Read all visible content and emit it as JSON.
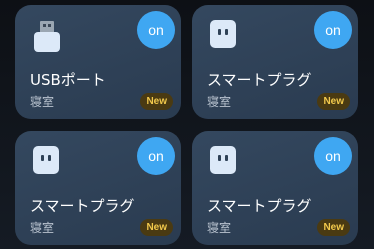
{
  "devices": [
    {
      "name": "USBポート",
      "room": "寝室",
      "toggle": "on",
      "badge": "New",
      "icon": "usb-stick-icon"
    },
    {
      "name": "スマートプラグ",
      "room": "寝室",
      "toggle": "on",
      "badge": "New",
      "icon": "smart-plug-icon"
    },
    {
      "name": "スマートプラグ",
      "room": "寝室",
      "toggle": "on",
      "badge": "New",
      "icon": "smart-plug-icon"
    },
    {
      "name": "スマートプラグ",
      "room": "寝室",
      "toggle": "on",
      "badge": "New",
      "icon": "smart-plug-icon"
    }
  ],
  "colors": {
    "tile": "#2f4257",
    "toggle_on": "#3fa7f2",
    "badge_text": "#f2c94c",
    "badge_bg": "#4a3a12"
  }
}
